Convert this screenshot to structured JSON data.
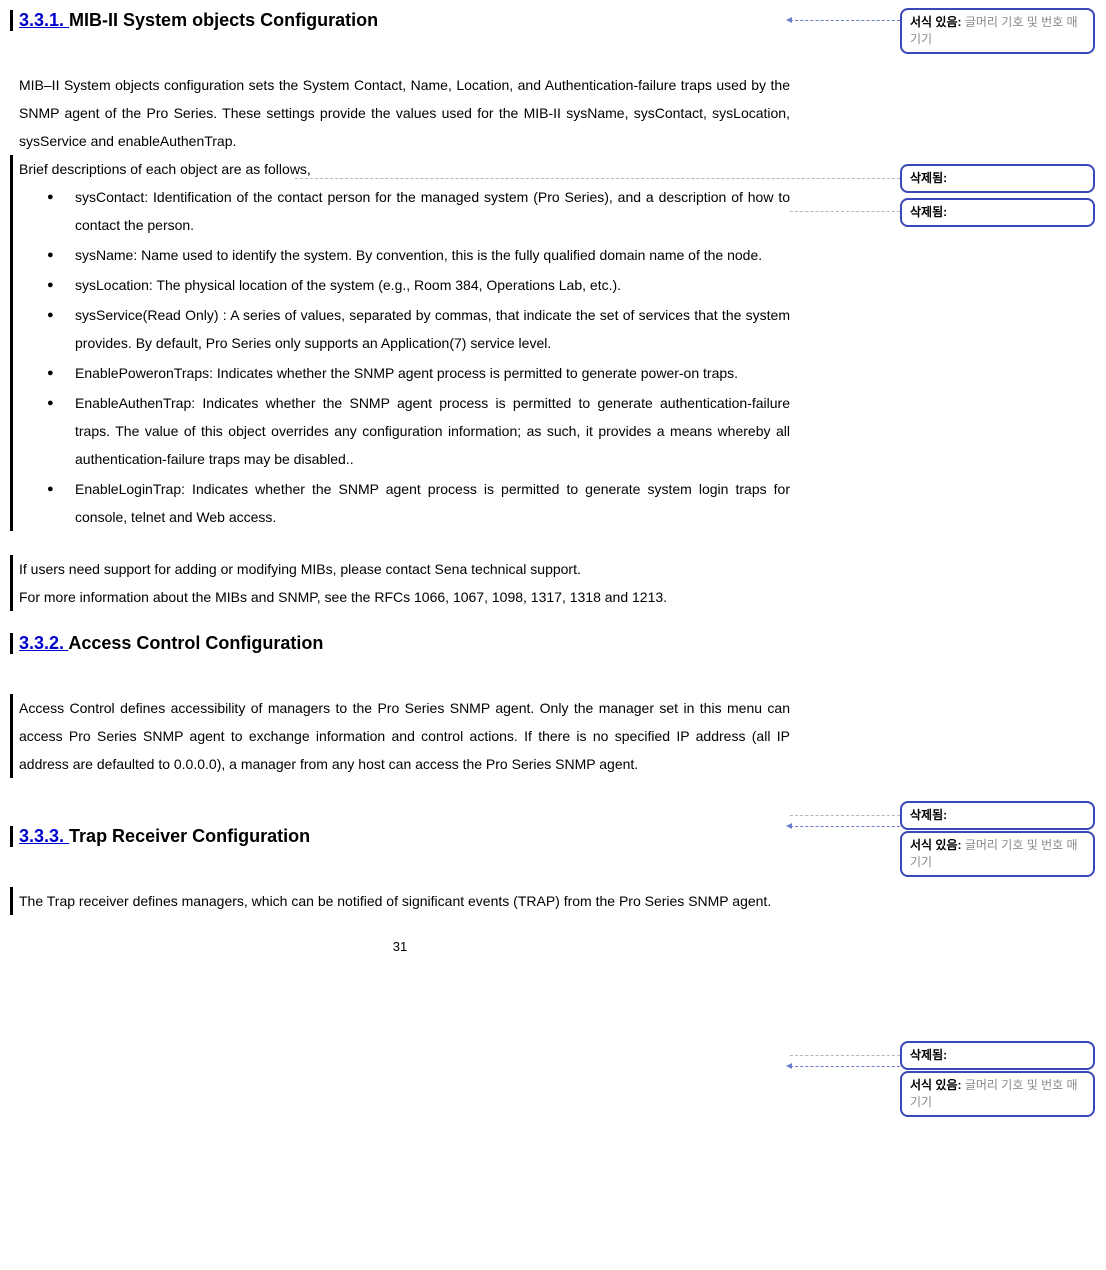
{
  "sections": {
    "s331": {
      "number": "3.3.1. ",
      "title": "MIB-II System objects Configuration",
      "para1": "MIB–II System objects configuration sets the System Contact, Name, Location, and Authentication-failure traps used by the SNMP agent of the Pro Series. These settings provide the values used for the MIB-II sysName, sysContact, sysLocation, sysService and enableAuthenTrap.",
      "brief": "Brief descriptions of each object are as follows,",
      "bullets": {
        "b1": "sysContact: Identification of the contact person for the managed system (Pro Series), and a description of how to contact the person.",
        "b2": "sysName: Name used to identify the system. By convention, this is the fully qualified domain name of the node.",
        "b3": "sysLocation: The physical location of the system (e.g., Room 384, Operations Lab, etc.).",
        "b4": "sysService(Read Only) : A series of values, separated by commas, that indicate the set of services that the system provides. By default, Pro Series only supports an Application(7) service level.",
        "b5": "EnablePoweronTraps: Indicates whether the SNMP agent process is permitted to generate power-on traps.",
        "b6": "EnableAuthenTrap: Indicates whether the SNMP agent process is permitted to generate authentication-failure traps. The value of this object overrides any configuration information; as such, it provides a means whereby all authentication-failure traps may be disabled..",
        "b7": "EnableLoginTrap: Indicates whether the SNMP agent process is permitted to generate system login traps for console, telnet and Web access."
      },
      "support": "If users need support for adding or modifying MIBs, please contact Sena technical support.",
      "moreinfo": "For more information about the MIBs and SNMP, see the RFCs 1066, 1067, 1098, 1317, 1318 and 1213."
    },
    "s332": {
      "number": "3.3.2. ",
      "title": "Access Control Configuration",
      "para": "Access Control defines accessibility of managers to the Pro Series SNMP agent. Only the manager set in this menu can access Pro Series SNMP agent to exchange information and control actions. If there is no specified IP address (all IP address are defaulted to 0.0.0.0), a manager from any host can access the Pro Series SNMP agent."
    },
    "s333": {
      "number": "3.3.3. ",
      "title": "Trap Receiver Configuration",
      "para": "The Trap receiver defines managers, which can be notified of significant events (TRAP) from the Pro Series SNMP agent."
    }
  },
  "comments": {
    "c1_label": "서식 있음:",
    "c1_text": " 글머리 기호 및 번호 매기기",
    "c2_label": "삭제됨:",
    "c2_text": " ",
    "c3_label": "삭제됨:",
    "c3_text": " ",
    "c4_label": "삭제됨:",
    "c4_text": " ",
    "c5_label": "서식 있음:",
    "c5_text": " 글머리 기호 및 번호 매기기",
    "c6_label": "삭제됨:",
    "c6_text": " ",
    "c7_label": "서식 있음:",
    "c7_text": " 글머리 기호 및 번호 매기기"
  },
  "page_number": "31"
}
